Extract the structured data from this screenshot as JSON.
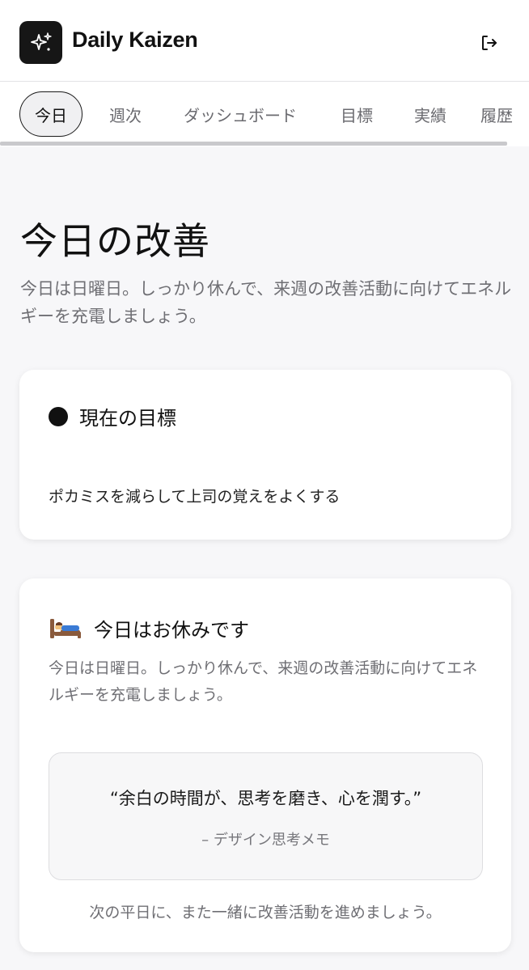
{
  "header": {
    "app_title": "Daily Kaizen",
    "logo_icon": "sparkles-icon",
    "logout_icon": "logout-icon"
  },
  "tabs": [
    {
      "label": "今日",
      "active": true
    },
    {
      "label": "週次",
      "active": false
    },
    {
      "label": "ダッシュボード",
      "active": false
    },
    {
      "label": "目標",
      "active": false
    },
    {
      "label": "実績",
      "active": false
    },
    {
      "label": "履歴",
      "active": false
    }
  ],
  "page": {
    "title": "今日の改善",
    "subtitle": "今日は日曜日。しっかり休んで、来週の改善活動に向けてエネルギーを充電しましょう。"
  },
  "goal_card": {
    "title": "現在の目標",
    "text": "ポカミスを減らして上司の覚えをよくする"
  },
  "rest_card": {
    "icon": "bed-icon",
    "title": "今日はお休みです",
    "description": "今日は日曜日。しっかり休んで、来週の改善活動に向けてエネルギーを充電しましょう。",
    "quote": "“余白の時間が、思考を磨き、心を潤す。”",
    "quote_author": "– デザイン思考メモ",
    "footer": "次の平日に、また一緒に改善活動を進めましょう。"
  },
  "colors": {
    "background": "#f7f7f9",
    "logo_bg": "#161616",
    "text_primary": "#111111",
    "text_secondary": "#6f6f74"
  }
}
